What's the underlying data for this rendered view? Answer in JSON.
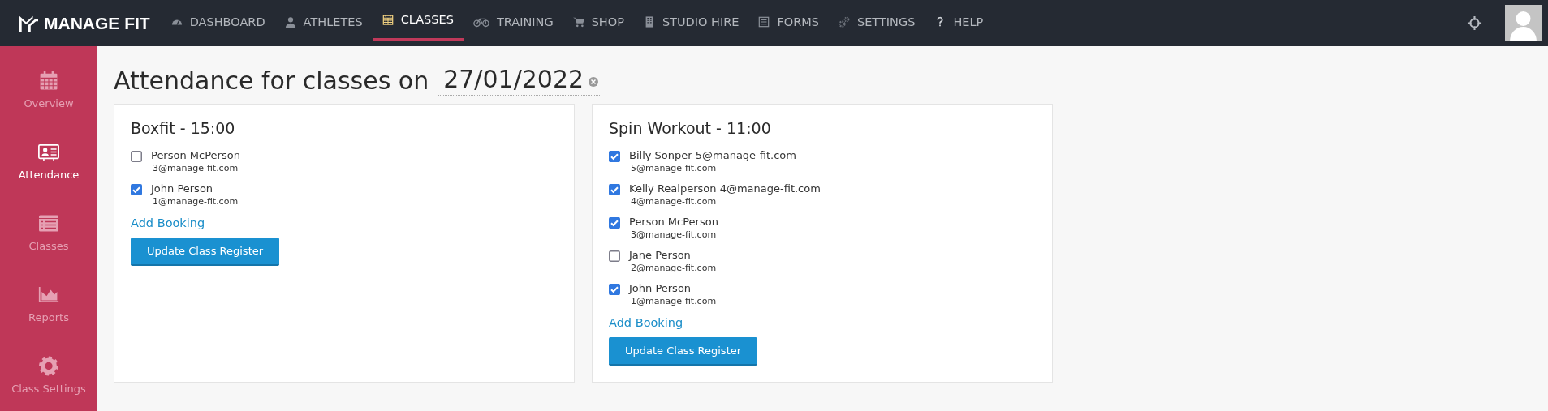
{
  "brand": {
    "name": "MANAGE FIT"
  },
  "nav": [
    {
      "label": "DASHBOARD",
      "selected": false
    },
    {
      "label": "ATHLETES",
      "selected": false
    },
    {
      "label": "CLASSES",
      "selected": true
    },
    {
      "label": "TRAINING",
      "selected": false
    },
    {
      "label": "SHOP",
      "selected": false
    },
    {
      "label": "STUDIO HIRE",
      "selected": false
    },
    {
      "label": "FORMS",
      "selected": false
    },
    {
      "label": "SETTINGS",
      "selected": false
    },
    {
      "label": "HELP",
      "selected": false
    }
  ],
  "sidebar": {
    "items": [
      {
        "label": "Overview",
        "selected": false
      },
      {
        "label": "Attendance",
        "selected": true
      },
      {
        "label": "Classes",
        "selected": false
      },
      {
        "label": "Reports",
        "selected": false
      },
      {
        "label": "Class Settings",
        "selected": false
      }
    ]
  },
  "page": {
    "title": "Attendance for classes on",
    "date": "27/01/2022"
  },
  "classes": [
    {
      "title": "Boxfit - 15:00",
      "attendees": [
        {
          "name": "Person McPerson",
          "email": "3@manage-fit.com",
          "checked": false
        },
        {
          "name": "John Person",
          "email": "1@manage-fit.com",
          "checked": true
        }
      ],
      "add_link": "Add Booking",
      "button": "Update Class Register"
    },
    {
      "title": "Spin Workout - 11:00",
      "attendees": [
        {
          "name": "Billy Sonper 5@manage-fit.com",
          "email": "5@manage-fit.com",
          "checked": true
        },
        {
          "name": "Kelly Realperson 4@manage-fit.com",
          "email": "4@manage-fit.com",
          "checked": true
        },
        {
          "name": "Person McPerson",
          "email": "3@manage-fit.com",
          "checked": true
        },
        {
          "name": "Jane Person",
          "email": "2@manage-fit.com",
          "checked": false
        },
        {
          "name": "John Person",
          "email": "1@manage-fit.com",
          "checked": true
        }
      ],
      "add_link": "Add Booking",
      "button": "Update Class Register"
    }
  ]
}
